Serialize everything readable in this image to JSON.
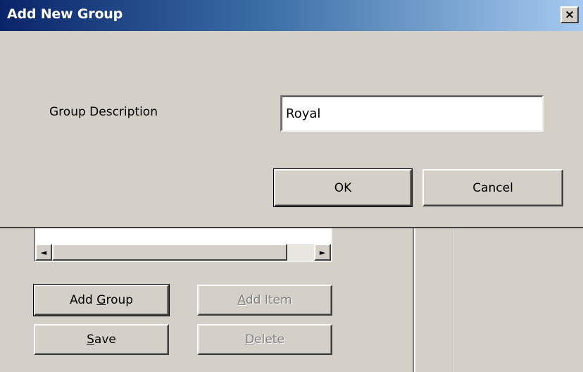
{
  "window": {
    "title": "Add New Group",
    "close_label": "×"
  },
  "dialog": {
    "group_description_label": "Group Description",
    "group_description_value": "Royal",
    "ok_label": "OK",
    "cancel_label": "Cancel"
  },
  "background_form": {
    "scroll_left_arrow": "◄",
    "scroll_right_arrow": "►",
    "add_group": {
      "before": "Add ",
      "mnemonic": "G",
      "after": "roup"
    },
    "add_item": {
      "before": "",
      "mnemonic": "A",
      "after": "dd Item"
    },
    "save": {
      "before": "",
      "mnemonic": "S",
      "after": "ave"
    },
    "delete": {
      "before": "",
      "mnemonic": "D",
      "after": "elete"
    }
  },
  "colors": {
    "titlebar_start": "#0a246a",
    "titlebar_end": "#a6caf0",
    "face": "#d4d0c8",
    "disabled_text": "#808080"
  }
}
